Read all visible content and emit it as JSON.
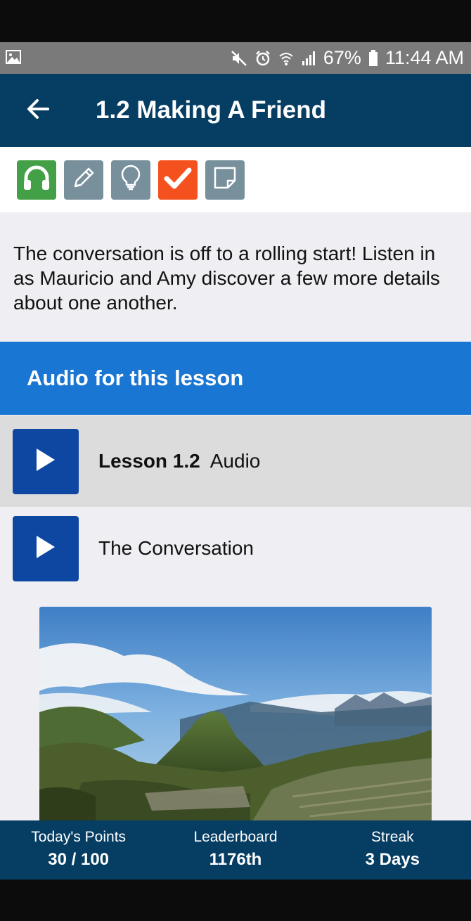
{
  "status_bar": {
    "battery": "67%",
    "time": "11:44 AM"
  },
  "header": {
    "title": "1.2 Making A Friend"
  },
  "toolbar": {
    "buttons": [
      {
        "icon": "headphones-icon",
        "color": "#43a047"
      },
      {
        "icon": "pencil-icon",
        "color": "#78909c"
      },
      {
        "icon": "lightbulb-icon",
        "color": "#78909c"
      },
      {
        "icon": "checkmark-icon",
        "color": "#f4511e"
      },
      {
        "icon": "note-icon",
        "color": "#78909c"
      }
    ]
  },
  "description": "The conversation is off to a rolling start! Listen in as Mauricio and Amy discover a few more details about one another.",
  "audio_section": {
    "title": "Audio for this lesson",
    "items": [
      {
        "label_bold": "Lesson 1.2",
        "label": "Audio"
      },
      {
        "label_bold": "",
        "label": "The Conversation"
      }
    ]
  },
  "footer": {
    "points_label": "Today's Points",
    "points_value": "30 / 100",
    "leaderboard_label": "Leaderboard",
    "leaderboard_value": "1176th",
    "streak_label": "Streak",
    "streak_value": "3 Days"
  },
  "colors": {
    "header_bg": "#063d63",
    "accent_blue": "#1976d2",
    "play_button": "#0d47a1"
  }
}
